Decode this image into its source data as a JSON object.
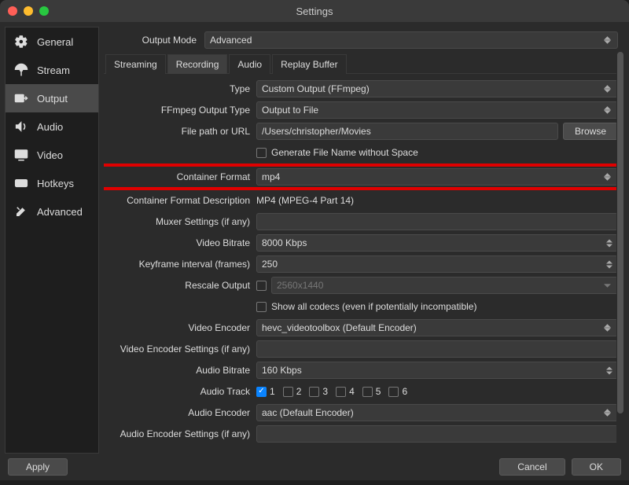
{
  "window": {
    "title": "Settings"
  },
  "sidebar": {
    "items": [
      {
        "key": "general",
        "label": "General"
      },
      {
        "key": "stream",
        "label": "Stream"
      },
      {
        "key": "output",
        "label": "Output"
      },
      {
        "key": "audio",
        "label": "Audio"
      },
      {
        "key": "video",
        "label": "Video"
      },
      {
        "key": "hotkeys",
        "label": "Hotkeys"
      },
      {
        "key": "advanced",
        "label": "Advanced"
      }
    ]
  },
  "output_mode": {
    "label": "Output Mode",
    "value": "Advanced"
  },
  "tabs": [
    {
      "key": "streaming",
      "label": "Streaming"
    },
    {
      "key": "recording",
      "label": "Recording"
    },
    {
      "key": "audio",
      "label": "Audio"
    },
    {
      "key": "replay",
      "label": "Replay Buffer"
    }
  ],
  "form": {
    "type": {
      "label": "Type",
      "value": "Custom Output (FFmpeg)"
    },
    "ffmpeg_output_type": {
      "label": "FFmpeg Output Type",
      "value": "Output to File"
    },
    "file_path": {
      "label": "File path or URL",
      "value": "/Users/christopher/Movies",
      "browse": "Browse"
    },
    "gen_filename": {
      "label": "Generate File Name without Space"
    },
    "container_format": {
      "label": "Container Format",
      "value": "mp4"
    },
    "container_desc": {
      "label": "Container Format Description",
      "value": "MP4 (MPEG-4 Part 14)"
    },
    "muxer": {
      "label": "Muxer Settings (if any)"
    },
    "video_bitrate": {
      "label": "Video Bitrate",
      "value": "8000 Kbps"
    },
    "keyframe": {
      "label": "Keyframe interval (frames)",
      "value": "250"
    },
    "rescale": {
      "label": "Rescale Output",
      "placeholder": "2560x1440"
    },
    "show_codecs": {
      "label": "Show all codecs (even if potentially incompatible)"
    },
    "video_encoder": {
      "label": "Video Encoder",
      "value": "hevc_videotoolbox (Default Encoder)"
    },
    "video_enc_settings": {
      "label": "Video Encoder Settings (if any)"
    },
    "audio_bitrate": {
      "label": "Audio Bitrate",
      "value": "160 Kbps"
    },
    "audio_track": {
      "label": "Audio Track",
      "tracks": [
        {
          "n": "1",
          "checked": true
        },
        {
          "n": "2",
          "checked": false
        },
        {
          "n": "3",
          "checked": false
        },
        {
          "n": "4",
          "checked": false
        },
        {
          "n": "5",
          "checked": false
        },
        {
          "n": "6",
          "checked": false
        }
      ]
    },
    "audio_encoder": {
      "label": "Audio Encoder",
      "value": "aac (Default Encoder)"
    },
    "audio_enc_settings": {
      "label": "Audio Encoder Settings (if any)"
    }
  },
  "footer": {
    "apply": "Apply",
    "cancel": "Cancel",
    "ok": "OK"
  }
}
